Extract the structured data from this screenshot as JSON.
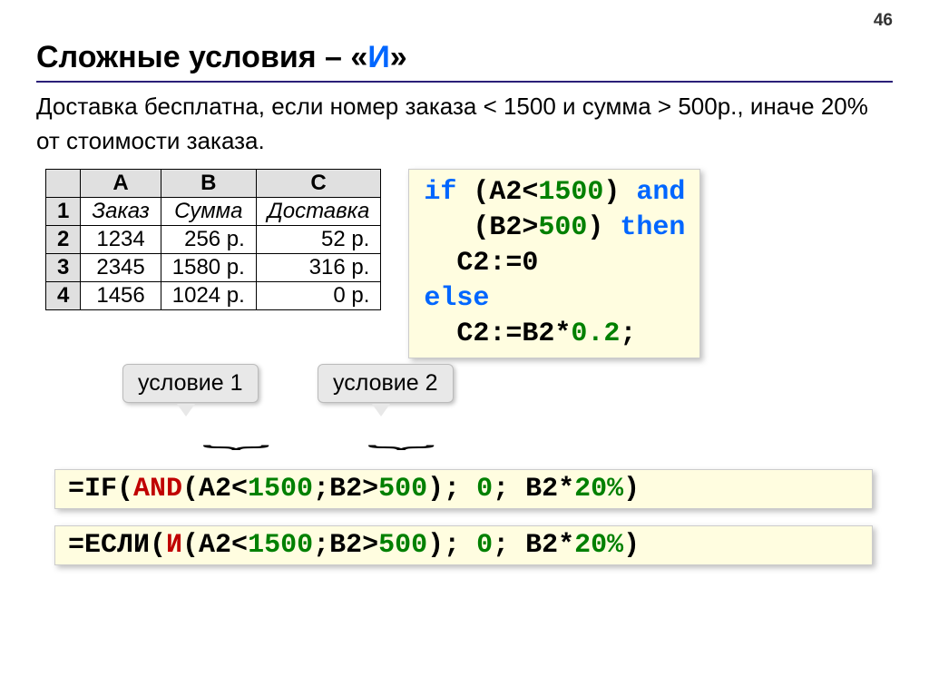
{
  "page_number": "46",
  "title_prefix": "Сложные условия – «",
  "title_accent": "И",
  "title_suffix": "»",
  "intro": "Доставка бесплатна, если номер заказа < 1500 и сумма > 500р., иначе 20% от стоимости заказа.",
  "thead": {
    "blank": "",
    "A": "A",
    "B": "B",
    "C": "C"
  },
  "rows": [
    {
      "n": "1",
      "a": "Заказ",
      "b": "Сумма",
      "c": "Доставка",
      "ital": true
    },
    {
      "n": "2",
      "a": "1234",
      "b": "256 р.",
      "c": "52 р."
    },
    {
      "n": "3",
      "a": "2345",
      "b": "1580 р.",
      "c": "316 р."
    },
    {
      "n": "4",
      "a": "1456",
      "b": "1024 р.",
      "c": "0 р."
    }
  ],
  "code": {
    "l1a": "if",
    "l1b": " (A2<",
    "l1c": "1500",
    "l1d": ") ",
    "l1e": "and",
    "l2a": "   (B2>",
    "l2b": "500",
    "l2c": ") ",
    "l2d": "then",
    "l3": "  C2:=0",
    "l4": "else",
    "l5a": "  C2:=B2*",
    "l5b": "0.2",
    "l5c": ";"
  },
  "callout1": "условие 1",
  "callout2": "условие 2",
  "formula1": {
    "a": "=IF(",
    "b": "AND",
    "c": "(A2<",
    "d": "1500",
    "e": ";B2>",
    "f": "500",
    "g": "); ",
    "h": "0",
    "i": "; B2*",
    "j": "20%",
    "k": ")"
  },
  "formula2": {
    "a": "=ЕСЛИ(",
    "b": "И",
    "c": "(A2<",
    "d": "1500",
    "e": ";B2>",
    "f": "500",
    "g": "); ",
    "h": "0",
    "i": "; B2*",
    "j": "20%",
    "k": ")"
  }
}
